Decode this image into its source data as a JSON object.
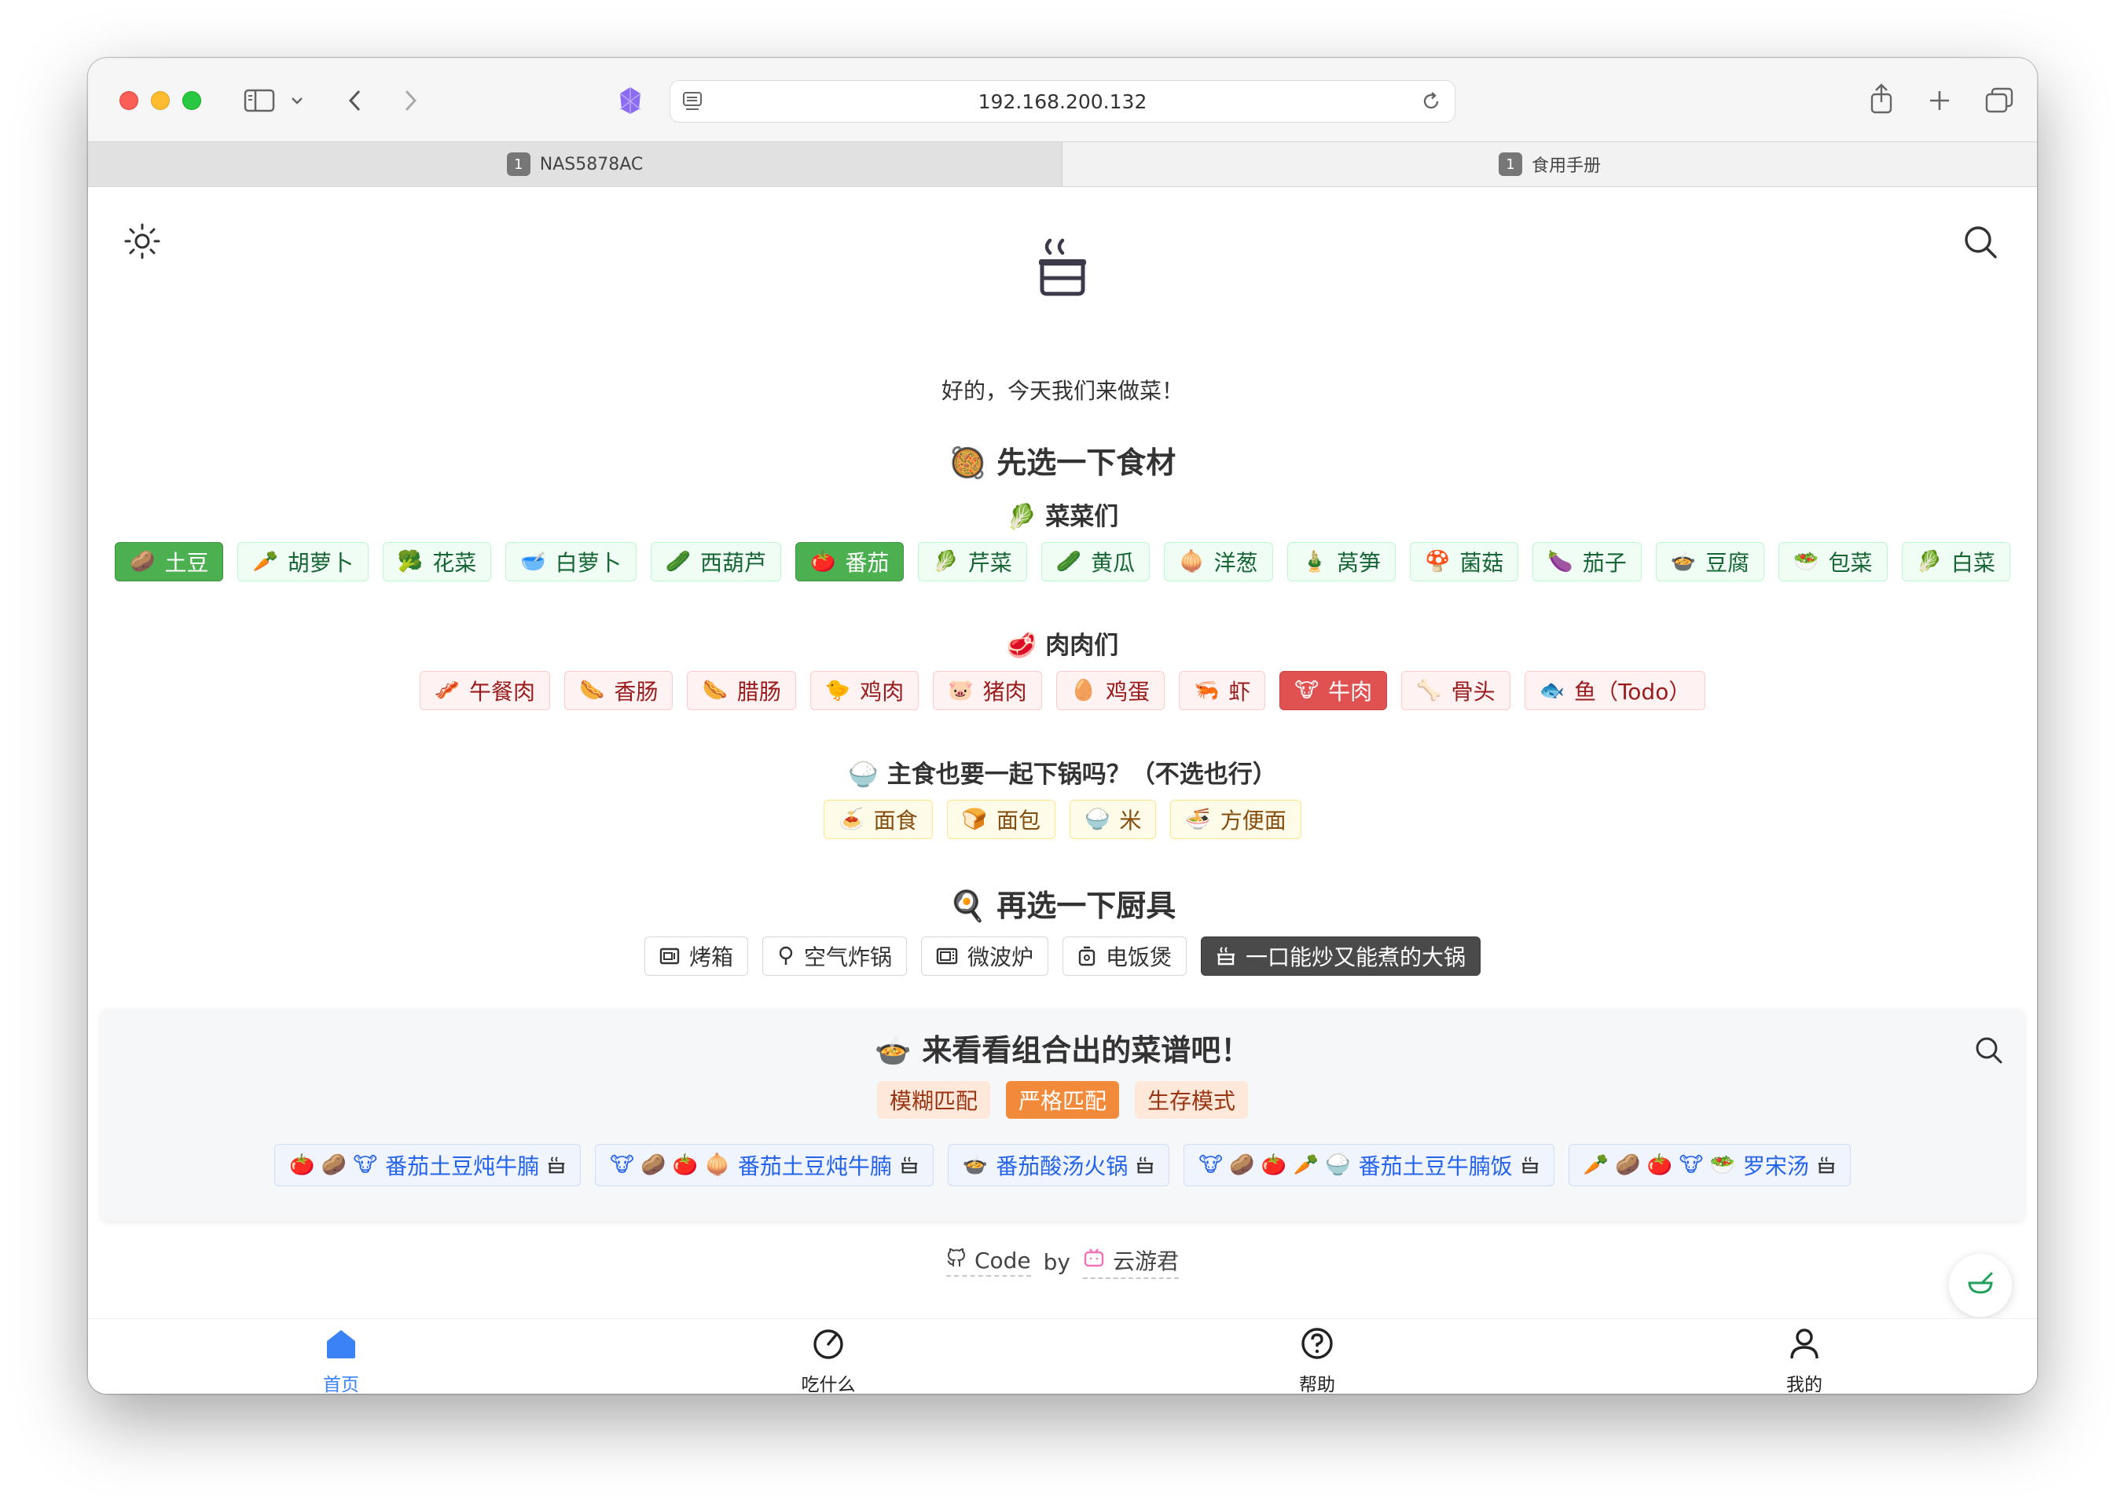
{
  "browser": {
    "url": "192.168.200.132",
    "tabs": [
      {
        "num": "1",
        "label": "NAS5878AC"
      },
      {
        "num": "1",
        "label": "食用手册"
      }
    ],
    "close_glyph": "×"
  },
  "header": {
    "subtitle": "好的，今天我们来做菜！"
  },
  "ingredients": {
    "title_emoji": "🥘",
    "title": "先选一下食材",
    "veg_title_emoji": "🥬",
    "veg_title": "菜菜们",
    "veg": [
      {
        "emoji": "🥔",
        "label": "土豆",
        "selected": true
      },
      {
        "emoji": "🥕",
        "label": "胡萝卜",
        "selected": false
      },
      {
        "emoji": "🥦",
        "label": "花菜",
        "selected": false
      },
      {
        "emoji": "🥣",
        "label": "白萝卜",
        "selected": false
      },
      {
        "emoji": "🥒",
        "label": "西葫芦",
        "selected": false
      },
      {
        "emoji": "🍅",
        "label": "番茄",
        "selected": true
      },
      {
        "emoji": "🥬",
        "label": "芹菜",
        "selected": false
      },
      {
        "emoji": "🥒",
        "label": "黄瓜",
        "selected": false
      },
      {
        "emoji": "🧅",
        "label": "洋葱",
        "selected": false
      },
      {
        "emoji": "🎍",
        "label": "莴笋",
        "selected": false
      },
      {
        "emoji": "🍄",
        "label": "菌菇",
        "selected": false
      },
      {
        "emoji": "🍆",
        "label": "茄子",
        "selected": false
      },
      {
        "emoji": "🍲",
        "label": "豆腐",
        "selected": false
      },
      {
        "emoji": "🥗",
        "label": "包菜",
        "selected": false
      },
      {
        "emoji": "🥬",
        "label": "白菜",
        "selected": false
      }
    ],
    "meat_title_emoji": "🥩",
    "meat_title": "肉肉们",
    "meat": [
      {
        "emoji": "🥓",
        "label": "午餐肉",
        "selected": false
      },
      {
        "emoji": "🌭",
        "label": "香肠",
        "selected": false
      },
      {
        "emoji": "🌭",
        "label": "腊肠",
        "selected": false
      },
      {
        "emoji": "🐤",
        "label": "鸡肉",
        "selected": false
      },
      {
        "emoji": "🐷",
        "label": "猪肉",
        "selected": false
      },
      {
        "emoji": "🥚",
        "label": "鸡蛋",
        "selected": false
      },
      {
        "emoji": "🦐",
        "label": "虾",
        "selected": false
      },
      {
        "emoji": "🐮",
        "label": "牛肉",
        "selected": true
      },
      {
        "emoji": "🦴",
        "label": "骨头",
        "selected": false
      },
      {
        "emoji": "🐟",
        "label": "鱼（Todo）",
        "selected": false
      }
    ],
    "staple_title_emoji": "🍚",
    "staple_title": "主食也要一起下锅吗？（不选也行）",
    "staple": [
      {
        "emoji": "🍝",
        "label": "面食"
      },
      {
        "emoji": "🍞",
        "label": "面包"
      },
      {
        "emoji": "🍚",
        "label": "米"
      },
      {
        "emoji": "🍜",
        "label": "方便面"
      }
    ]
  },
  "tools": {
    "title_emoji": "🍳",
    "title": "再选一下厨具",
    "items": [
      {
        "icon": "oven-icon",
        "label": "烤箱",
        "selected": false
      },
      {
        "icon": "air-fryer-icon",
        "label": "空气炸锅",
        "selected": false
      },
      {
        "icon": "microwave-icon",
        "label": "微波炉",
        "selected": false
      },
      {
        "icon": "rice-cooker-icon",
        "label": "电饭煲",
        "selected": false
      },
      {
        "icon": "pot-icon",
        "label": "一口能炒又能煮的大锅",
        "selected": true
      }
    ]
  },
  "results": {
    "title_emoji": "🍲",
    "title": "来看看组合出的菜谱吧！",
    "modes": [
      {
        "key": "fuzzy",
        "label": "模糊匹配"
      },
      {
        "key": "strict",
        "label": "严格匹配"
      },
      {
        "key": "survive",
        "label": "生存模式"
      }
    ],
    "recipes": [
      {
        "emojis": "🍅 🥔 🐮",
        "label": "番茄土豆炖牛腩"
      },
      {
        "emojis": "🐮 🥔 🍅 🧅",
        "label": "番茄土豆炖牛腩"
      },
      {
        "emojis": "🍲",
        "label": "番茄酸汤火锅"
      },
      {
        "emojis": "🐮 🥔 🍅 🥕 🍚",
        "label": "番茄土豆牛腩饭"
      },
      {
        "emojis": "🥕 🥔 🍅 🐮 🥗",
        "label": "罗宋汤"
      }
    ]
  },
  "footer": {
    "code": "Code",
    "by": "by",
    "author": "云游君"
  },
  "nav": [
    {
      "icon": "home-icon",
      "label": "首页",
      "active": true
    },
    {
      "icon": "dice-icon",
      "label": "吃什么",
      "active": false
    },
    {
      "icon": "help-icon",
      "label": "帮助",
      "active": false
    },
    {
      "icon": "user-icon",
      "label": "我的",
      "active": false
    }
  ],
  "colors": {
    "veg_selected": "#4caf50",
    "meat_selected": "#e05252",
    "mode_selected": "#f28a3c",
    "nav_active": "#3b82f6"
  }
}
